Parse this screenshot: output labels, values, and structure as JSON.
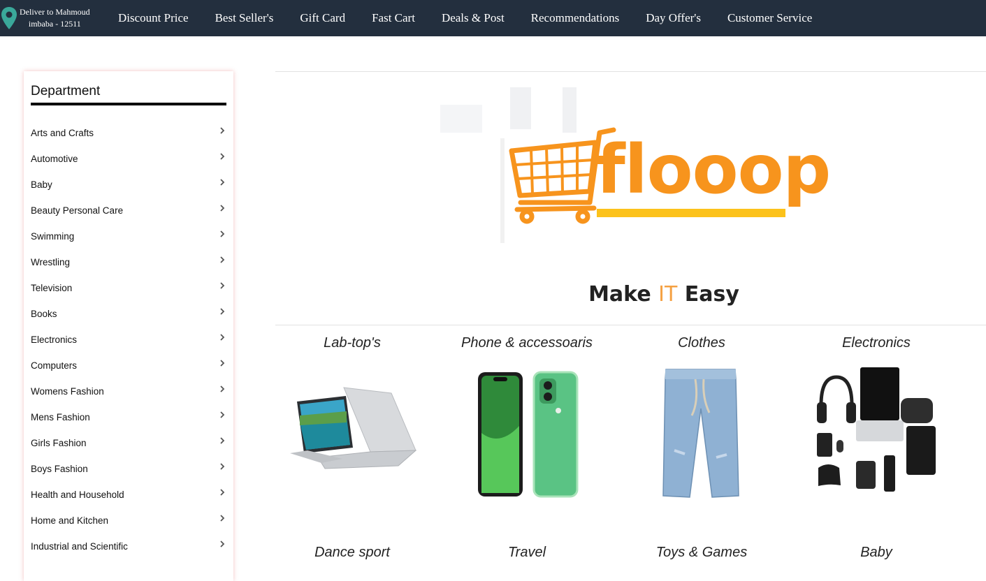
{
  "header": {
    "deliver_line1": "Deliver to Mahmoud",
    "deliver_line2": "imbaba - 12511",
    "nav": [
      "Discount Price",
      "Best Seller's",
      "Gift Card",
      "Fast Cart",
      "Deals & Post",
      "Recommendations",
      "Day Offer's",
      "Customer Service"
    ]
  },
  "sidebar": {
    "title": "Department",
    "items": [
      "Arts and Crafts",
      "Automotive",
      "Baby",
      "Beauty Personal Care",
      "Swimming",
      "Wrestling",
      "Television",
      "Books",
      "Electronics",
      "Computers",
      "Womens Fashion",
      "Mens Fashion",
      "Girls Fashion",
      "Boys Fashion",
      "Health and Household",
      "Home and Kitchen",
      "Industrial and Scientific"
    ]
  },
  "brand": {
    "logo_text": "flooop",
    "tagline_pre": "Make ",
    "tagline_hl": "IT",
    "tagline_post": " Easy"
  },
  "categories": {
    "row1": [
      "Lab-top's",
      "Phone & accessoaris",
      "Clothes",
      "Electronics"
    ],
    "row2": [
      "Dance sport",
      "Travel",
      "Toys & Games",
      "Baby"
    ]
  },
  "colors": {
    "topbar": "#232f3e",
    "brand_orange": "#f7941d",
    "underline_yellow": "#fcc21b",
    "pin": "#3aa89a"
  },
  "icons": {
    "location": "location-pin-icon",
    "chevron": "chevron-right-icon",
    "cart": "shopping-cart-icon"
  }
}
